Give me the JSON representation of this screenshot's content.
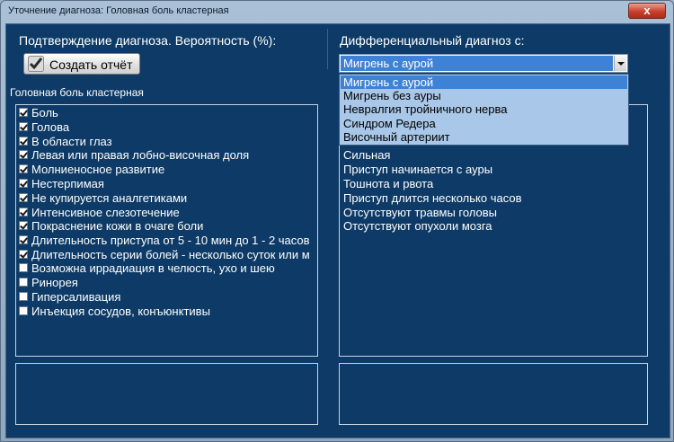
{
  "window": {
    "title": "Уточнение диагноза: Головная боль кластерная",
    "close_label": "x"
  },
  "header": {
    "confirm_label": "Подтверждение диагноза. Вероятность (%):",
    "report_button": "Создать отчёт",
    "differential_label": "Дифференциальный диагноз с:"
  },
  "left_panel": {
    "title": "Головная боль кластерная",
    "symptoms": [
      {
        "label": "Боль",
        "checked": true
      },
      {
        "label": "Голова",
        "checked": true
      },
      {
        "label": "В области глаз",
        "checked": true
      },
      {
        "label": "Левая или правая лобно-височная доля",
        "checked": true
      },
      {
        "label": "Молниеносное развитие",
        "checked": true
      },
      {
        "label": "Нестерпимая",
        "checked": true
      },
      {
        "label": "Не купируется аналгетиками",
        "checked": true
      },
      {
        "label": "Интенсивное слезотечение",
        "checked": true
      },
      {
        "label": "Покраснение кожи в очаге боли",
        "checked": true
      },
      {
        "label": "Длительность приступа от 5 - 10 мин до 1 - 2 часов",
        "checked": true
      },
      {
        "label": "Длительность серии болей - несколько суток или м",
        "checked": true
      },
      {
        "label": "Возможна иррадиация в челюсть, ухо и шею",
        "checked": false
      },
      {
        "label": "Ринорея",
        "checked": false
      },
      {
        "label": "Гиперсаливация",
        "checked": false
      },
      {
        "label": "Инъекция сосудов, конъюнктивы",
        "checked": false
      }
    ]
  },
  "differential": {
    "selected": "Мигрень с аурой",
    "options": [
      "Мигрень с аурой",
      "Мигрень без ауры",
      "Невралгия тройничного нерва",
      "Синдром Редера",
      "Височный артериит"
    ],
    "features": [
      "Сильная",
      "Приступ начинается с ауры",
      "Тошнота и рвота",
      "Приступ длится несколько часов",
      "Отсутствуют травмы головы",
      "Отсутствуют опухоли мозга"
    ]
  }
}
